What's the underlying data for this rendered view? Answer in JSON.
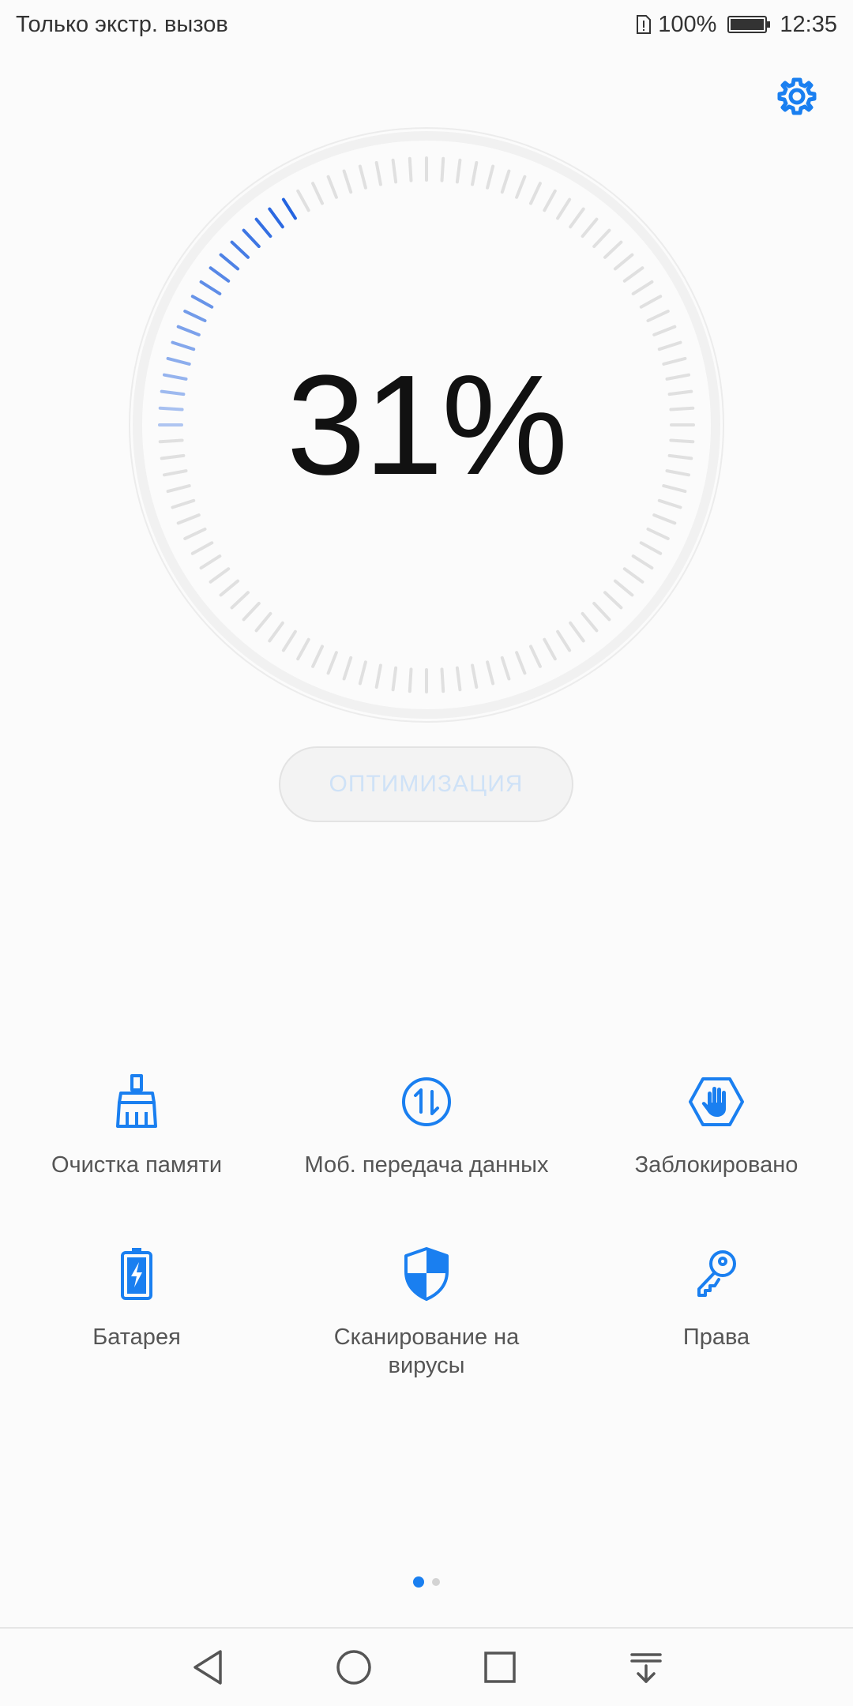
{
  "status_bar": {
    "carrier": "Только экстр. вызов",
    "battery": "100%",
    "time": "12:35"
  },
  "gauge": {
    "value_text": "31%",
    "progress_percent": 31,
    "active_color": "#2464e0",
    "inactive_color": "#e0e0e0"
  },
  "optimize": {
    "label": "ОПТИМИЗАЦИЯ"
  },
  "tools": [
    {
      "label": "Очистка памяти",
      "icon": "broom-icon"
    },
    {
      "label": "Моб. передача данных",
      "icon": "data-transfer-icon"
    },
    {
      "label": "Заблокировано",
      "icon": "blocked-hand-icon"
    },
    {
      "label": "Батарея",
      "icon": "battery-charge-icon"
    },
    {
      "label": "Сканирование на вирусы",
      "icon": "shield-icon"
    },
    {
      "label": "Права",
      "icon": "key-icon"
    }
  ],
  "page_indicator": {
    "pages": 2,
    "active": 0
  },
  "colors": {
    "accent": "#1a7ff0",
    "text": "#555555"
  },
  "nav": [
    "back-icon",
    "home-icon",
    "recents-icon",
    "notifications-pull-icon"
  ]
}
